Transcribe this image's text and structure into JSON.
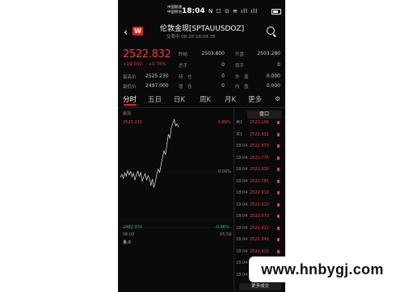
{
  "status_bar": {
    "carrier_line1": "中国联通",
    "carrier_line2": "中国移动",
    "time": "18:04",
    "icons": "N ☐ ⊙ ≋ ıll ıll"
  },
  "header": {
    "logo_text": "W",
    "title": "伦敦金现[SPTAUUSDOZ]",
    "subtitle": "交易中 08-20 18:04:35"
  },
  "quote": {
    "price": "2522.832",
    "change": "+19.032",
    "change_pct": "+0.76%",
    "stats": [
      {
        "label": "最高价",
        "value": "2525.230"
      },
      {
        "label": "最低价",
        "value": "2497.000"
      },
      {
        "label": "昨结",
        "value": "2503.800"
      },
      {
        "label": "总手",
        "value": "0"
      },
      {
        "label": "持　仓",
        "value": "0"
      },
      {
        "label": "增　仓",
        "value": "0"
      },
      {
        "label": "开盘",
        "value": "2503.280"
      },
      {
        "label": "现手",
        "value": "0"
      },
      {
        "label": "外　盘",
        "value": "0.000"
      },
      {
        "label": "内　盘",
        "value": "0.000"
      }
    ]
  },
  "tabs": [
    {
      "label": "分时",
      "active": true
    },
    {
      "label": "五日",
      "active": false
    },
    {
      "label": "日K",
      "active": false
    },
    {
      "label": "周K",
      "active": false
    },
    {
      "label": "月K",
      "active": false
    },
    {
      "label": "更多",
      "active": false
    }
  ],
  "chart_labels": {
    "tag": "最加",
    "y_max": "2525.230",
    "y_min": "2482.370",
    "pct_max": "0.86%",
    "pct_mid": "0.00%",
    "pct_min": "-0.86%",
    "x_start": "06:00",
    "x_end": "05:59",
    "volume": "量:0"
  },
  "chart_data": {
    "type": "line",
    "x": [
      "06:00",
      "18:04"
    ],
    "ylim": [
      2482.37,
      2525.23
    ],
    "series": [
      {
        "values": [
          2501.5,
          2502.8,
          2501.2,
          2503.4,
          2502.0,
          2504.3,
          2502.5,
          2503.9,
          2501.8,
          2503.2,
          2500.4,
          2502.6,
          2504.1,
          2501.9,
          2503.5,
          2499.8,
          2501.7,
          2503.0,
          2500.5,
          2502.2,
          2501.0,
          2498.2,
          2500.9,
          2497.3,
          2499.6,
          2502.8,
          2504.9,
          2503.6,
          2506.8,
          2509.5,
          2512.4,
          2510.8,
          2514.9,
          2519.2,
          2517.4,
          2521.8,
          2523.5,
          2525.2,
          2522.6,
          2523.4,
          2522.0
        ]
      }
    ]
  },
  "order_book": {
    "header": "盘口",
    "rows": [
      {
        "time": "卖1",
        "price": "2523.100"
      },
      {
        "time": "买1",
        "price": "2522.832"
      },
      {
        "time": "18:04",
        "price": "2522.970"
      },
      {
        "time": "18:04",
        "price": "2522.775"
      },
      {
        "time": "18:04",
        "price": "2522.930"
      },
      {
        "time": "18:04",
        "price": "2522.785"
      },
      {
        "time": "18:04",
        "price": "2522.910"
      },
      {
        "time": "18:04",
        "price": "2522.910"
      },
      {
        "time": "18:04",
        "price": "2522.870"
      },
      {
        "time": "18:04",
        "price": "2522.812"
      },
      {
        "time": "18:04",
        "price": "2522.849"
      },
      {
        "time": "18:04",
        "price": "2522.832"
      },
      {
        "time": "18:04",
        "price": "2522.832"
      },
      {
        "time": "18:04",
        "price": "2522.832"
      }
    ],
    "more_label": "更多成交"
  },
  "watermark": "www.hnbygj.com",
  "colors": {
    "up": "#e84040",
    "down": "#2fbf5a",
    "background": "#0a0a0a",
    "accent": "#e02020"
  }
}
